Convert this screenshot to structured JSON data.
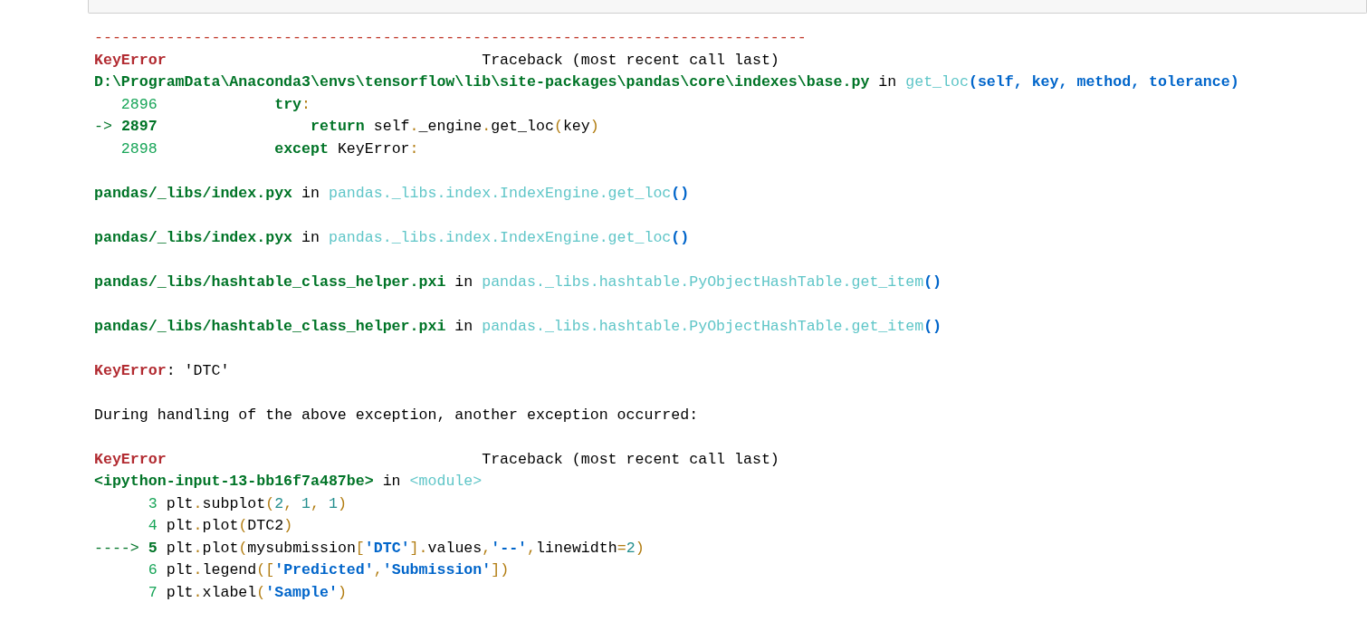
{
  "output_lines": [
    {
      "kind": "text",
      "segments": [
        {
          "kind": "rule",
          "text": "-------------------------------------------------------------------------------"
        }
      ]
    },
    {
      "kind": "text",
      "segments": [
        {
          "kind": "ename",
          "text": "KeyError"
        },
        {
          "kind": "plain",
          "text": "                                   Traceback (most recent call last)"
        }
      ]
    },
    {
      "kind": "text",
      "segments": [
        {
          "kind": "file",
          "text": "D:\\ProgramData\\Anaconda3\\envs\\tensorflow\\lib\\site-packages\\pandas\\core\\indexes\\base.py"
        },
        {
          "kind": "plain",
          "text": " in "
        },
        {
          "kind": "func",
          "text": "get_loc"
        },
        {
          "kind": "args",
          "text": "(self, key, method, tolerance)"
        }
      ]
    },
    {
      "kind": "text",
      "segments": [
        {
          "kind": "lineno",
          "text": "   2896"
        },
        {
          "kind": "keyword",
          "text": "             try"
        },
        {
          "kind": "op",
          "text": ":"
        }
      ]
    },
    {
      "kind": "text",
      "segments": [
        {
          "kind": "arrow",
          "text": "-> "
        },
        {
          "kind": "current_lineno",
          "text": "2897"
        },
        {
          "kind": "keyword",
          "text": "                 return"
        },
        {
          "kind": "plain",
          "text": " self"
        },
        {
          "kind": "op",
          "text": "."
        },
        {
          "kind": "plain",
          "text": "_engine"
        },
        {
          "kind": "op",
          "text": "."
        },
        {
          "kind": "plain",
          "text": "get_loc"
        },
        {
          "kind": "op",
          "text": "("
        },
        {
          "kind": "plain",
          "text": "key"
        },
        {
          "kind": "op",
          "text": ")"
        }
      ]
    },
    {
      "kind": "text",
      "segments": [
        {
          "kind": "lineno",
          "text": "   2898"
        },
        {
          "kind": "keyword",
          "text": "             except"
        },
        {
          "kind": "plain",
          "text": " KeyError"
        },
        {
          "kind": "op",
          "text": ":"
        }
      ]
    },
    {
      "kind": "blank"
    },
    {
      "kind": "text",
      "segments": [
        {
          "kind": "file",
          "text": "pandas/_libs/index.pyx"
        },
        {
          "kind": "plain",
          "text": " in "
        },
        {
          "kind": "func",
          "text": "pandas._libs.index.IndexEngine.get_loc"
        },
        {
          "kind": "args",
          "text": "()"
        }
      ]
    },
    {
      "kind": "blank"
    },
    {
      "kind": "text",
      "segments": [
        {
          "kind": "file",
          "text": "pandas/_libs/index.pyx"
        },
        {
          "kind": "plain",
          "text": " in "
        },
        {
          "kind": "func",
          "text": "pandas._libs.index.IndexEngine.get_loc"
        },
        {
          "kind": "args",
          "text": "()"
        }
      ]
    },
    {
      "kind": "blank"
    },
    {
      "kind": "text",
      "segments": [
        {
          "kind": "file",
          "text": "pandas/_libs/hashtable_class_helper.pxi"
        },
        {
          "kind": "plain",
          "text": " in "
        },
        {
          "kind": "func",
          "text": "pandas._libs.hashtable.PyObjectHashTable.get_item"
        },
        {
          "kind": "args",
          "text": "()"
        }
      ]
    },
    {
      "kind": "blank"
    },
    {
      "kind": "text",
      "segments": [
        {
          "kind": "file",
          "text": "pandas/_libs/hashtable_class_helper.pxi"
        },
        {
          "kind": "plain",
          "text": " in "
        },
        {
          "kind": "func",
          "text": "pandas._libs.hashtable.PyObjectHashTable.get_item"
        },
        {
          "kind": "args",
          "text": "()"
        }
      ]
    },
    {
      "kind": "blank"
    },
    {
      "kind": "text",
      "segments": [
        {
          "kind": "ename",
          "text": "KeyError"
        },
        {
          "kind": "plain",
          "text": ": 'DTC'"
        }
      ]
    },
    {
      "kind": "blank"
    },
    {
      "kind": "text",
      "segments": [
        {
          "kind": "plain",
          "text": "During handling of the above exception, another exception occurred:"
        }
      ]
    },
    {
      "kind": "blank"
    },
    {
      "kind": "text",
      "segments": [
        {
          "kind": "ename",
          "text": "KeyError"
        },
        {
          "kind": "plain",
          "text": "                                   Traceback (most recent call last)"
        }
      ]
    },
    {
      "kind": "text",
      "segments": [
        {
          "kind": "file",
          "text": "<ipython-input-13-bb16f7a487be>"
        },
        {
          "kind": "plain",
          "text": " in "
        },
        {
          "kind": "func",
          "text": "<module>"
        }
      ]
    },
    {
      "kind": "text",
      "segments": [
        {
          "kind": "lineno",
          "text": "      3"
        },
        {
          "kind": "plain",
          "text": " plt"
        },
        {
          "kind": "op",
          "text": "."
        },
        {
          "kind": "plain",
          "text": "subplot"
        },
        {
          "kind": "op",
          "text": "("
        },
        {
          "kind": "number",
          "text": "2"
        },
        {
          "kind": "op",
          "text": ", "
        },
        {
          "kind": "number",
          "text": "1"
        },
        {
          "kind": "op",
          "text": ", "
        },
        {
          "kind": "number",
          "text": "1"
        },
        {
          "kind": "op",
          "text": ")"
        }
      ]
    },
    {
      "kind": "text",
      "segments": [
        {
          "kind": "lineno",
          "text": "      4"
        },
        {
          "kind": "plain",
          "text": " plt"
        },
        {
          "kind": "op",
          "text": "."
        },
        {
          "kind": "plain",
          "text": "plot"
        },
        {
          "kind": "op",
          "text": "("
        },
        {
          "kind": "plain",
          "text": "DTC2"
        },
        {
          "kind": "op",
          "text": ")"
        }
      ]
    },
    {
      "kind": "text",
      "segments": [
        {
          "kind": "arrow",
          "text": "----> "
        },
        {
          "kind": "current_lineno",
          "text": "5"
        },
        {
          "kind": "plain",
          "text": " plt"
        },
        {
          "kind": "op",
          "text": "."
        },
        {
          "kind": "plain",
          "text": "plot"
        },
        {
          "kind": "op",
          "text": "("
        },
        {
          "kind": "plain",
          "text": "mysubmission"
        },
        {
          "kind": "op",
          "text": "["
        },
        {
          "kind": "string",
          "text": "'DTC'"
        },
        {
          "kind": "op",
          "text": "]."
        },
        {
          "kind": "plain",
          "text": "values"
        },
        {
          "kind": "op",
          "text": ","
        },
        {
          "kind": "string",
          "text": "'--'"
        },
        {
          "kind": "op",
          "text": ","
        },
        {
          "kind": "plain",
          "text": "linewidth"
        },
        {
          "kind": "op",
          "text": "="
        },
        {
          "kind": "number",
          "text": "2"
        },
        {
          "kind": "op",
          "text": ")"
        }
      ]
    },
    {
      "kind": "text",
      "segments": [
        {
          "kind": "lineno",
          "text": "      6"
        },
        {
          "kind": "plain",
          "text": " plt"
        },
        {
          "kind": "op",
          "text": "."
        },
        {
          "kind": "plain",
          "text": "legend"
        },
        {
          "kind": "op",
          "text": "(["
        },
        {
          "kind": "string",
          "text": "'Predicted'"
        },
        {
          "kind": "op",
          "text": ","
        },
        {
          "kind": "string",
          "text": "'Submission'"
        },
        {
          "kind": "op",
          "text": "])"
        }
      ]
    },
    {
      "kind": "text",
      "segments": [
        {
          "kind": "lineno",
          "text": "      7"
        },
        {
          "kind": "plain",
          "text": " plt"
        },
        {
          "kind": "op",
          "text": "."
        },
        {
          "kind": "plain",
          "text": "xlabel"
        },
        {
          "kind": "op",
          "text": "("
        },
        {
          "kind": "string",
          "text": "'Sample'"
        },
        {
          "kind": "op",
          "text": ")"
        }
      ]
    }
  ]
}
